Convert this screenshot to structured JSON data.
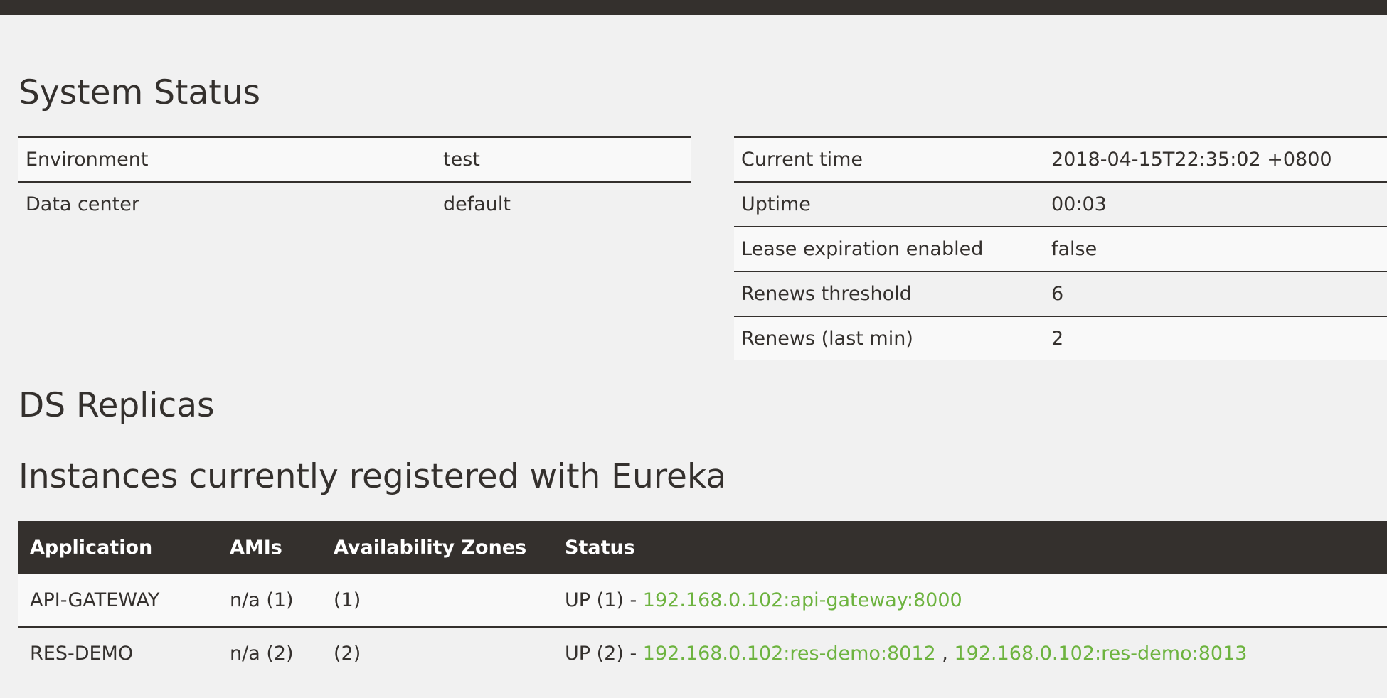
{
  "system_status": {
    "title": "System Status",
    "left_table": [
      {
        "key": "Environment",
        "value": "test"
      },
      {
        "key": "Data center",
        "value": "default"
      }
    ],
    "right_table": [
      {
        "key": "Current time",
        "value": "2018-04-15T22:35:02 +0800"
      },
      {
        "key": "Uptime",
        "value": "00:03"
      },
      {
        "key": "Lease expiration enabled",
        "value": "false"
      },
      {
        "key": "Renews threshold",
        "value": "6"
      },
      {
        "key": "Renews (last min)",
        "value": "2"
      }
    ]
  },
  "ds_replicas": {
    "title": "DS Replicas"
  },
  "instances": {
    "title": "Instances currently registered with Eureka",
    "columns": [
      "Application",
      "AMIs",
      "Availability Zones",
      "Status"
    ],
    "rows": [
      {
        "application": "API-GATEWAY",
        "amis": "n/a (1)",
        "zones": "(1)",
        "status_prefix": "UP (1) - ",
        "links": [
          "192.168.0.102:api-gateway:8000"
        ],
        "separator": ""
      },
      {
        "application": "RES-DEMO",
        "amis": "n/a (2)",
        "zones": "(2)",
        "status_prefix": "UP (2) - ",
        "links": [
          "192.168.0.102:res-demo:8012",
          "192.168.0.102:res-demo:8013"
        ],
        "separator": " , "
      }
    ]
  },
  "colors": {
    "dark": "#34302d",
    "link_green": "#6db33f",
    "background": "#f1f1f1",
    "row_light": "#f9f9f9"
  }
}
